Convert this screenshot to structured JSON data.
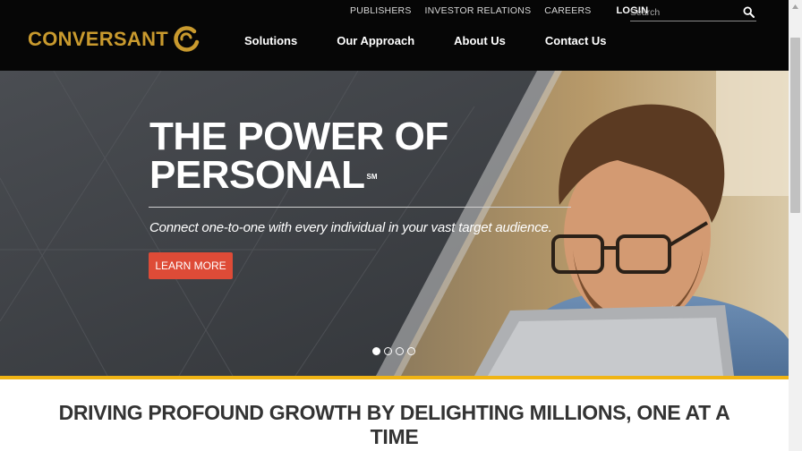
{
  "header": {
    "utility_links": [
      {
        "label": "PUBLISHERS"
      },
      {
        "label": "INVESTOR RELATIONS"
      },
      {
        "label": "CAREERS"
      }
    ],
    "login_label": "LOGIN",
    "search": {
      "placeholder": "Search"
    },
    "logo_text": "CONVERSANT",
    "nav": [
      {
        "label": "Solutions"
      },
      {
        "label": "Our Approach"
      },
      {
        "label": "About Us"
      },
      {
        "label": "Contact Us"
      }
    ]
  },
  "hero": {
    "title_line1": "THE POWER OF",
    "title_line2": "PERSONAL",
    "service_mark": "SM",
    "subtitle": "Connect one-to-one with every individual in your vast target audience.",
    "cta_label": "LEARN MORE",
    "slide_count": 4,
    "active_slide": 1
  },
  "tagline": "DRIVING PROFOUND GROWTH BY DELIGHTING MILLIONS, ONE AT A TIME",
  "colors": {
    "header_bg": "#060606",
    "brand_gold": "#c99a2e",
    "accent_bar": "#f0b414",
    "cta_red": "#de4b37",
    "hero_bg": "#3b3e42"
  },
  "icons": {
    "search": "search-icon",
    "logo_mark": "conversant-logo-mark-icon"
  }
}
